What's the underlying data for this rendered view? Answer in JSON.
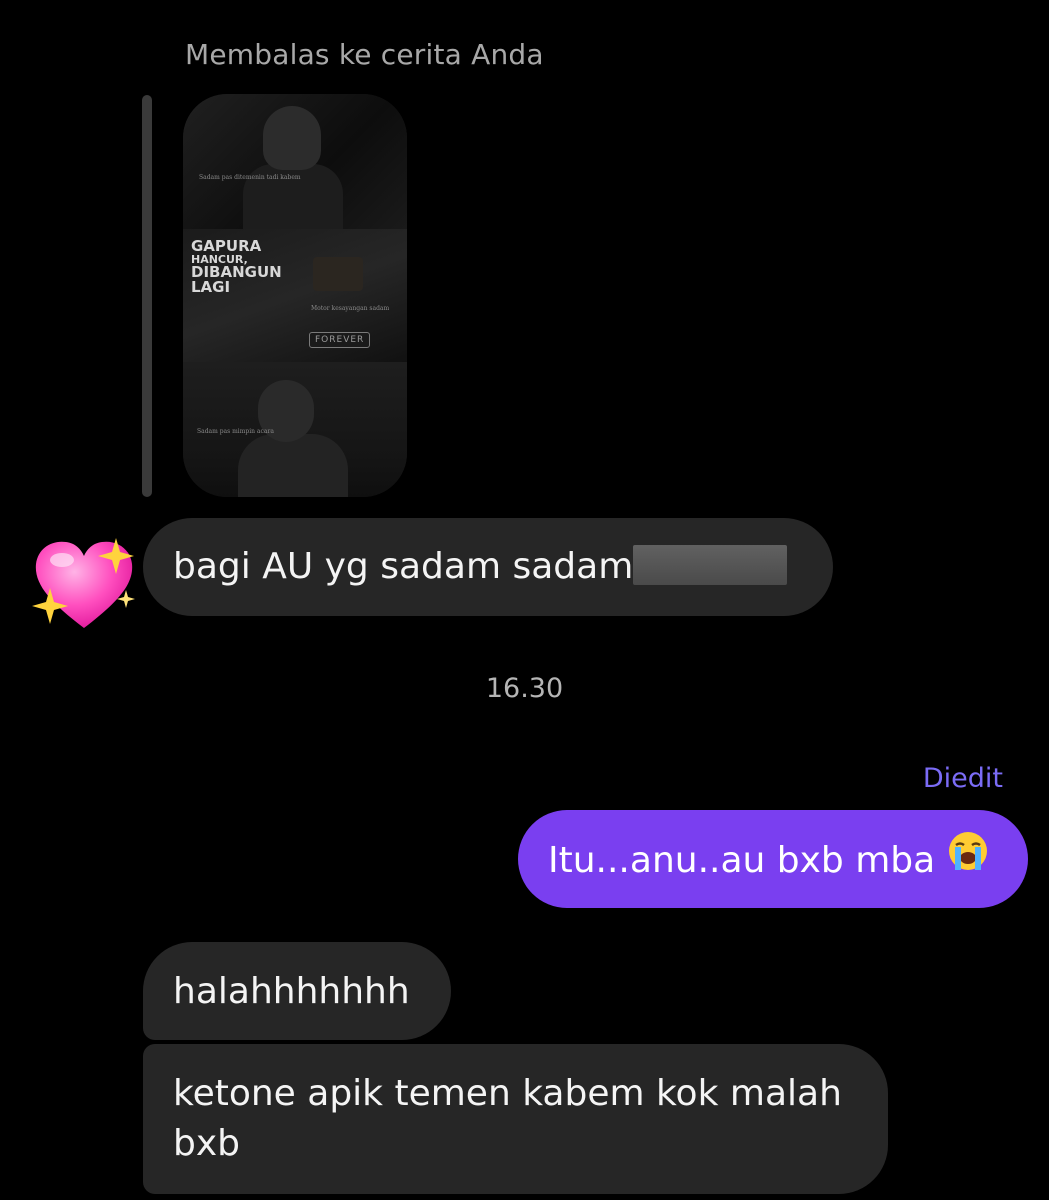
{
  "reply": {
    "label": "Membalas ke cerita Anda",
    "story": {
      "caption_top": "Sadam pas ditemenin tadi kabem",
      "headline_line1": "GAPURA",
      "headline_line2": "HANCUR,",
      "headline_line3": "DIBANGUN",
      "headline_line4": "LAGI",
      "caption_mid": "Motor kesayangan sadam",
      "badge": "FOREVER",
      "caption_bottom": "Sadam pas mimpin acara"
    }
  },
  "reaction": {
    "emoji": "sparkling-heart"
  },
  "messages": [
    {
      "direction": "incoming",
      "text": "bagi AU yg sadam sadam",
      "redacted": true
    },
    {
      "direction": "outgoing",
      "text": "Itu...anu..au bxb mba",
      "emoji": "loudly-crying-face"
    },
    {
      "direction": "incoming",
      "text": "halahhhhhhh"
    },
    {
      "direction": "incoming",
      "text": "ketone apik temen kabem kok malah bxb"
    }
  ],
  "timestamp": "16.30",
  "edited_label": "Diedit",
  "colors": {
    "background": "#000000",
    "incoming_bubble": "#262626",
    "outgoing_bubble": "#7a3ff0",
    "edited": "#7b6cf6",
    "meta_text": "#a8a8a8"
  }
}
